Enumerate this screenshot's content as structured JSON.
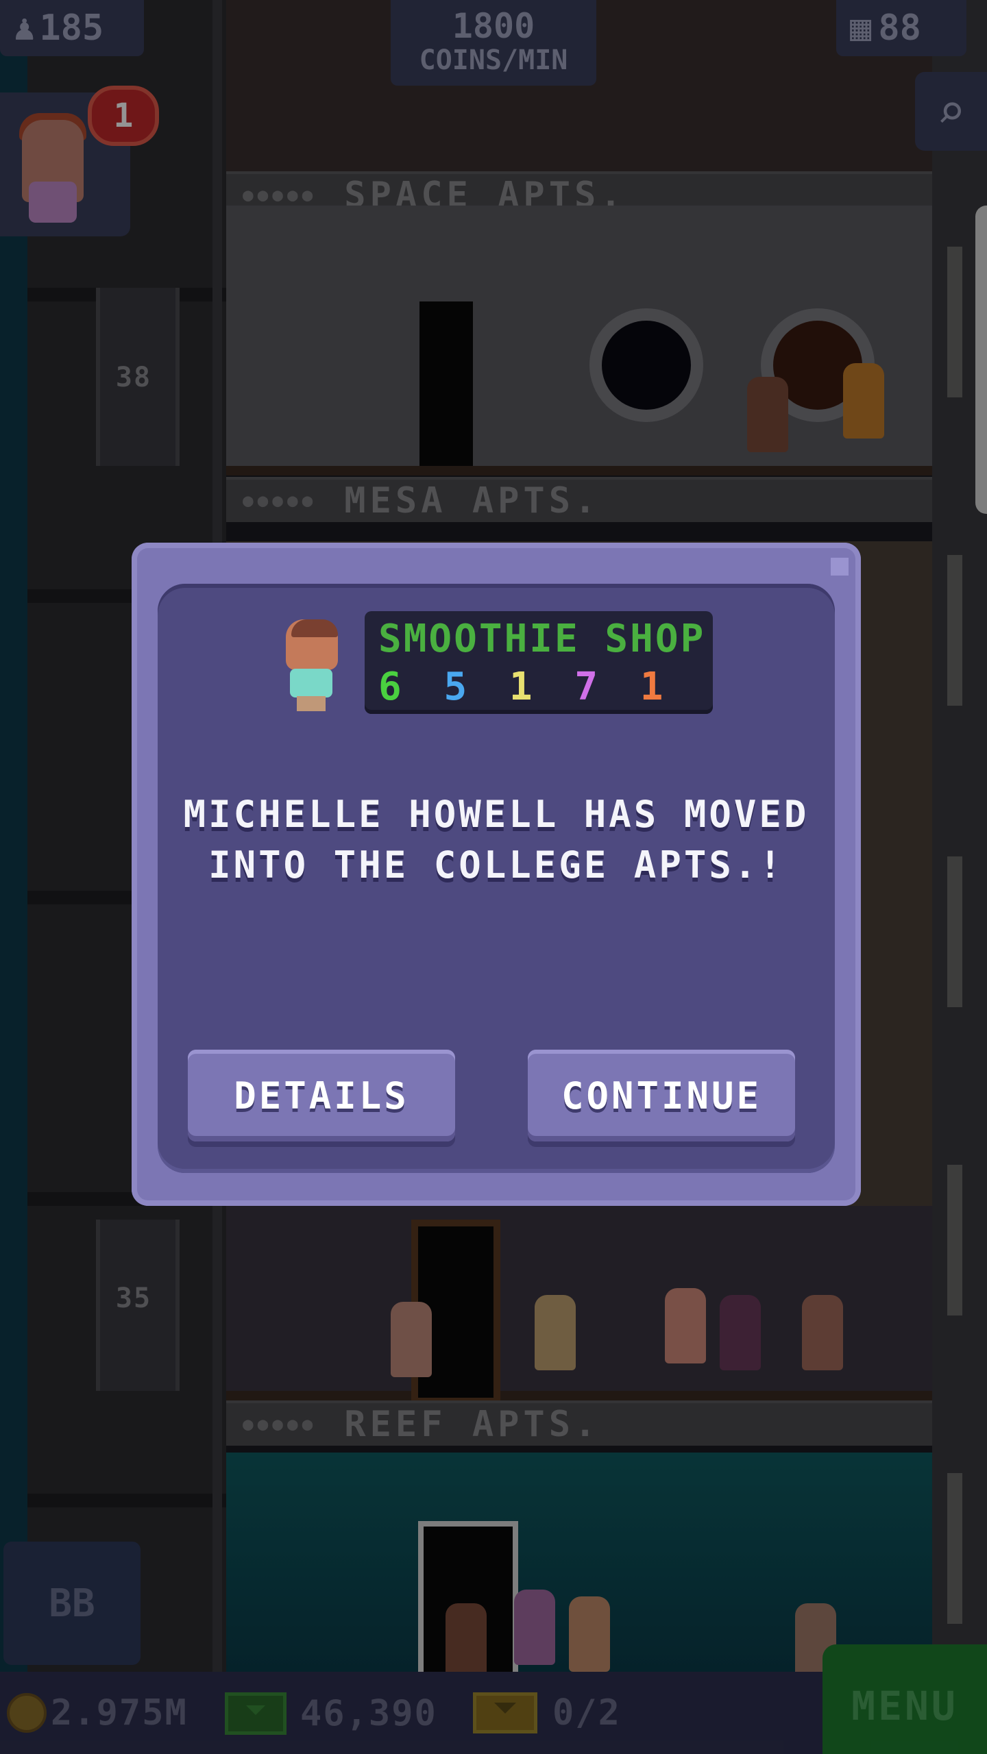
{
  "hud": {
    "population": "185",
    "coin_rate_value": "1800",
    "coin_rate_unit": "COINS/MIN",
    "floor_count": "88",
    "notification_count": "1"
  },
  "tower": {
    "floor_labels": [
      "SPACE APTS.",
      "MESA APTS.",
      "REEF APTS."
    ],
    "shaft_numbers": [
      "38",
      "35"
    ]
  },
  "dialog": {
    "shop_name": "SMOOTHIE SHOP",
    "shop_code_digits": [
      {
        "digit": "6",
        "color": "#4ad040"
      },
      {
        "digit": "5",
        "color": "#4aa8f0"
      },
      {
        "digit": "1",
        "color": "#e8e070"
      },
      {
        "digit": "7",
        "color": "#d070e8"
      },
      {
        "digit": "1",
        "color": "#f07a40"
      }
    ],
    "message": "MICHELLE HOWELL HAS MOVED INTO THE COLLEGE APTS.!",
    "details_label": "DETAILS",
    "continue_label": "CONTINUE"
  },
  "bottom_bar": {
    "coins": "2.975M",
    "bux": "46,390",
    "tickets": "0/2",
    "menu_label": "MENU",
    "bb_label": "BB"
  },
  "colors": {
    "dialog_frame": "#7c76b4",
    "dialog_inner": "#4e4a80",
    "menu_green": "#1e7a2e",
    "hud_panel": "#3a3e5c"
  },
  "icons": [
    "person-icon",
    "grid-icon",
    "search-icon",
    "coin-icon",
    "bux-icon",
    "ticket-icon",
    "down-arrow-icon"
  ]
}
